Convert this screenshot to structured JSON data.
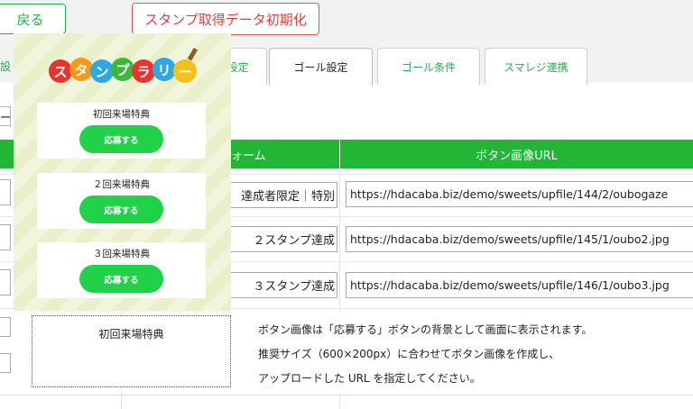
{
  "buttons": {
    "back": "戻る",
    "reset": "スタンプ取得データ初期化"
  },
  "tabs": [
    {
      "label": "設",
      "state": "partial"
    },
    {
      "label": "設定",
      "state": "partial"
    },
    {
      "label": "ゴール設定",
      "state": "active"
    },
    {
      "label": "ゴール条件",
      "state": "normal"
    },
    {
      "label": "スマレジ連携",
      "state": "normal"
    }
  ],
  "section_fragment": "ー",
  "table": {
    "headers": {
      "name": "ォーム",
      "url": "ボタン画像URL"
    },
    "rows": [
      {
        "name": "達成者限定｜特別",
        "url": "https://hdacaba.biz/demo/sweets/upfile/144/2/oubogaze"
      },
      {
        "name": "２スタンプ達成",
        "url": "https://hdacaba.biz/demo/sweets/upfile/145/1/oubo2.jpg"
      },
      {
        "name": "３スタンプ達成",
        "url": "https://hdacaba.biz/demo/sweets/upfile/146/1/oubo3.jpg"
      }
    ]
  },
  "preview": {
    "logo_text": "スタンプラリー",
    "cards": [
      {
        "title": "初回来場特典",
        "button": "応募する"
      },
      {
        "title": "２回来場特典",
        "button": "応募する"
      },
      {
        "title": "３回来場特典",
        "button": "応募する"
      }
    ],
    "colors": {
      "bg": "#e9f0c9",
      "button": "#22d14a"
    }
  },
  "dotted_box": {
    "title": "初回来場特典"
  },
  "help": {
    "lines": [
      "ボタン画像は「応募する」ボタンの背景として画面に表示されます。",
      "推奨サイズ（600×200px）に合わせてボタン画像を作成し、",
      "アップロードした URL を指定してください。"
    ]
  },
  "colors": {
    "accent": "#22b536",
    "danger": "#e0403a"
  }
}
